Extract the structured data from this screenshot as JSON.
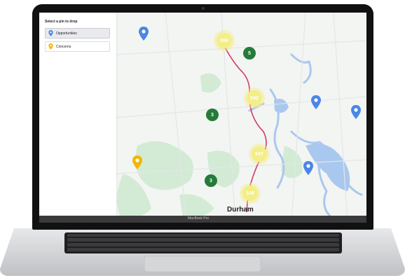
{
  "panel": {
    "title": "Select a pin to drop",
    "options": [
      {
        "label": "Opportunities",
        "color": "#4a86e8",
        "active": true
      },
      {
        "label": "Concerns",
        "color": "#f2b705",
        "active": false
      }
    ]
  },
  "map": {
    "city_label": "Durham",
    "route_color": "#d23c6b",
    "water_color": "#a9c8ef",
    "park_color": "#cfe9d2",
    "clusters": [
      {
        "count": "550",
        "kind": "yellow"
      },
      {
        "count": "5",
        "kind": "green"
      },
      {
        "count": "542",
        "kind": "yellow"
      },
      {
        "count": "3",
        "kind": "green"
      },
      {
        "count": "547",
        "kind": "yellow"
      },
      {
        "count": "3",
        "kind": "green"
      },
      {
        "count": "108",
        "kind": "yellow"
      }
    ],
    "pins": [
      {
        "type": "opportunity",
        "color": "#4a86e8"
      },
      {
        "type": "opportunity",
        "color": "#4a86e8"
      },
      {
        "type": "opportunity",
        "color": "#4a86e8"
      },
      {
        "type": "opportunity",
        "color": "#4a86e8"
      },
      {
        "type": "concern",
        "color": "#f2b705"
      }
    ]
  },
  "device": {
    "brand": "MacBook Pro"
  }
}
